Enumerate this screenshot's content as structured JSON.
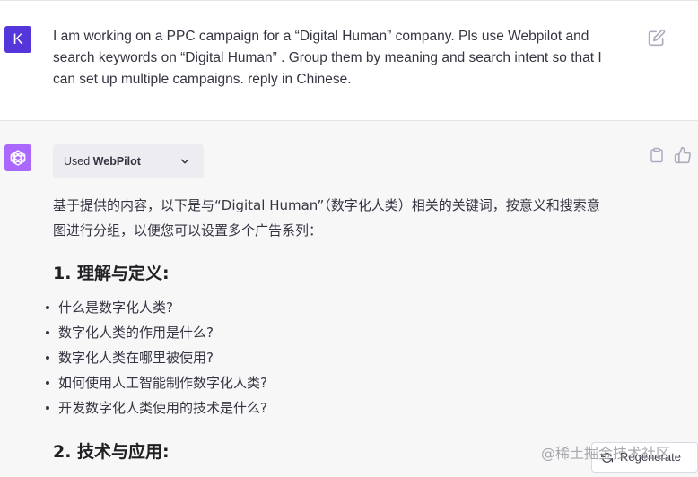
{
  "user_message": {
    "avatar_letter": "K",
    "avatar_color": "#5436da",
    "lines": [
      "I am working on a PPC campaign for a “Digital Human” company. Pls use Webpilot and",
      "search   keywords on “Digital Human” . Group them by meaning and search intent so that I",
      "can set up multiple campaigns. reply in Chinese."
    ],
    "edit_icon": "edit-icon"
  },
  "assistant_message": {
    "avatar_icon": "openai-logo-icon",
    "avatar_color": "#ab68ff",
    "plugin": {
      "used_label": "Used",
      "plugin_name": "WebPilot",
      "chevron_icon": "chevron-down-icon"
    },
    "actions": {
      "copy_icon": "clipboard-icon",
      "like_icon": "thumbs-up-icon"
    },
    "intro_lines": [
      "基于提供的内容，以下是与“Digital Human”（数字化人类）相关的关键词，按意义和搜索意",
      "图进行分组，以便您可以设置多个广告系列："
    ],
    "sections": [
      {
        "heading": "1. 理解与定义:",
        "items": [
          "什么是数字化人类?",
          "数字化人类的作用是什么?",
          "数字化人类在哪里被使用?",
          "如何使用人工智能制作数字化人类?",
          "开发数字化人类使用的技术是什么?"
        ]
      },
      {
        "heading": "2. 技术与应用:"
      }
    ]
  },
  "regenerate": {
    "label": "Regenerate",
    "icon": "refresh-icon"
  },
  "watermark": "@稀土掘金技术社区"
}
